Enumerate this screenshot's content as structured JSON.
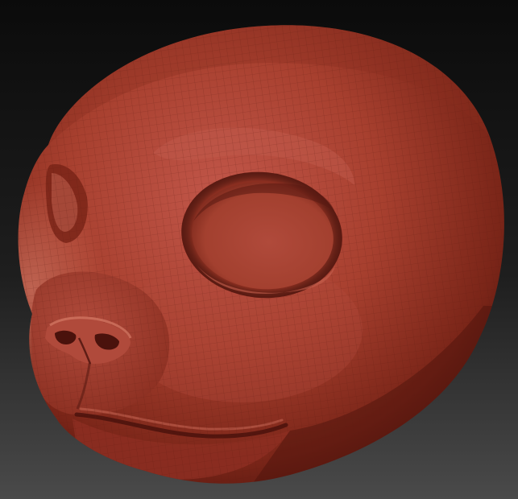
{
  "viewport": {
    "background_top": "#0b0b0b",
    "background_bottom": "#4a4a4a"
  },
  "model": {
    "material_color": "#a8402f",
    "shadow_color": "#4a120c",
    "highlight_color": "#e28a76",
    "wireframe_color": "#5a1a12",
    "wireframe_visible": true
  }
}
